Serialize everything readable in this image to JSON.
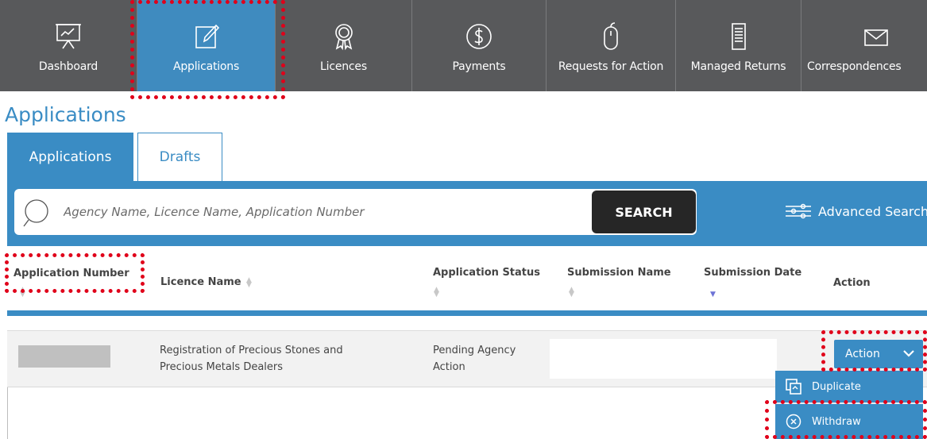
{
  "nav": {
    "items": [
      {
        "label": "Dashboard",
        "icon": "presentation-chart-icon"
      },
      {
        "label": "Applications",
        "icon": "edit-square-icon",
        "active": true
      },
      {
        "label": "Licences",
        "icon": "award-ribbon-icon"
      },
      {
        "label": "Payments",
        "icon": "dollar-circle-icon"
      },
      {
        "label": "Requests for Action",
        "icon": "mouse-icon"
      },
      {
        "label": "Managed Returns",
        "icon": "document-list-icon"
      },
      {
        "label": "Correspondences",
        "icon": "envelope-icon"
      }
    ]
  },
  "page": {
    "title": "Applications"
  },
  "tabs": [
    {
      "label": "Applications",
      "active": true
    },
    {
      "label": "Drafts",
      "active": false
    }
  ],
  "search": {
    "placeholder": "Agency Name, Licence Name, Application Number",
    "button_label": "SEARCH",
    "advanced_label": "Advanced Search"
  },
  "table": {
    "headers": {
      "application_number": "Application Number",
      "licence_name": "Licence Name",
      "application_status": "Application Status",
      "submission_name": "Submission Name",
      "submission_date": "Submission Date",
      "action": "Action"
    },
    "rows": [
      {
        "application_number": "",
        "licence_name_line1": "Registration of Precious Stones and",
        "licence_name_line2": "Precious Metals Dealers",
        "status_line1": "Pending Agency",
        "status_line2": "Action",
        "submission_name": "",
        "submission_date": "",
        "action_label": "Action"
      }
    ]
  },
  "action_menu": {
    "items": [
      {
        "label": "Duplicate",
        "icon": "duplicate-icon"
      },
      {
        "label": "Withdraw",
        "icon": "close-circle-icon"
      }
    ]
  },
  "colors": {
    "nav_bg": "#58595b",
    "accent": "#3a8cc4",
    "highlight": "#e0001a",
    "search_button": "#262626"
  }
}
